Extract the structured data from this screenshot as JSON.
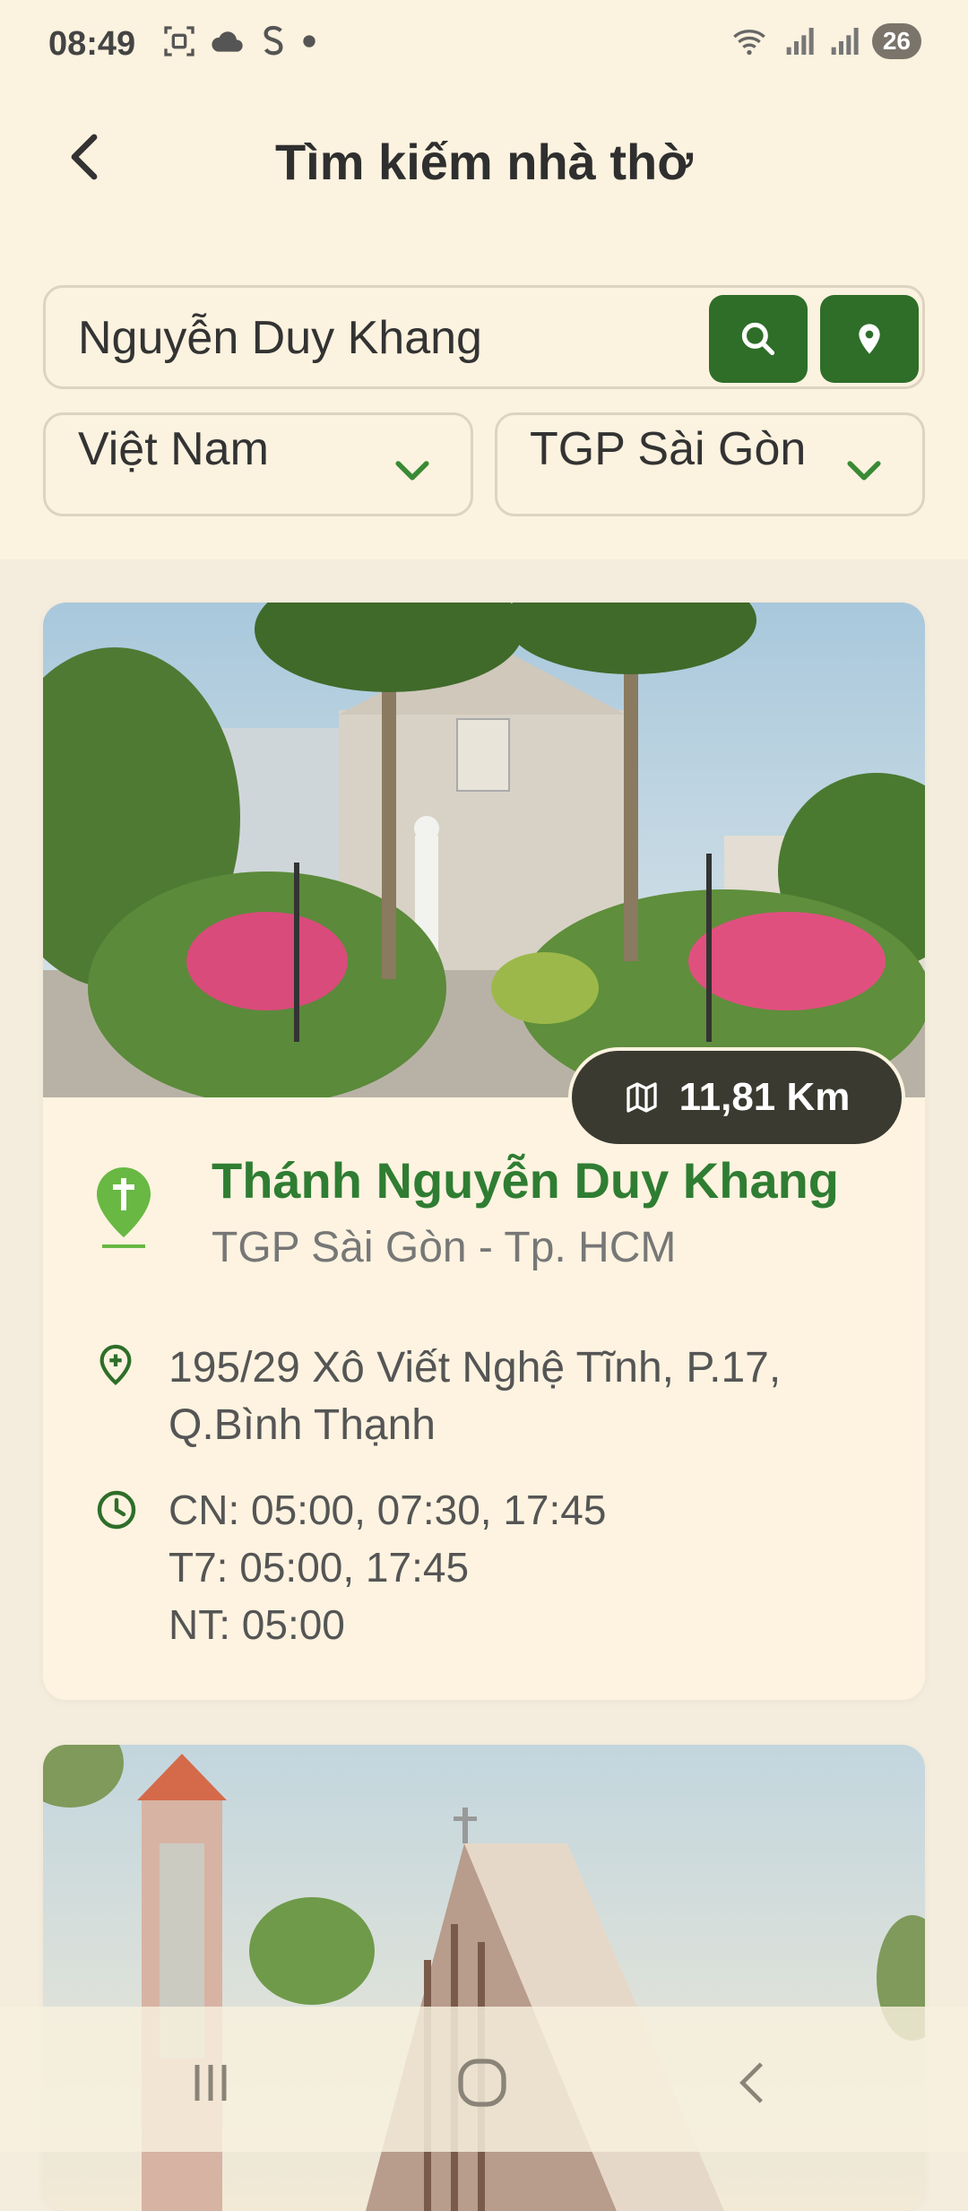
{
  "status": {
    "time": "08:49",
    "battery": "26",
    "icons_left": [
      "screenshot-icon",
      "cloud-icon",
      "s-icon",
      "dot-icon"
    ],
    "icons_right": [
      "wifi-icon",
      "signal-icon",
      "signal-icon"
    ]
  },
  "header": {
    "title": "Tìm kiếm nhà thờ"
  },
  "search": {
    "value": "Nguyễn Duy Khang"
  },
  "filters": {
    "country": "Việt Nam",
    "diocese": "TGP Sài Gòn"
  },
  "results": [
    {
      "distance": "11,81 Km",
      "name": "Thánh Nguyễn Duy Khang",
      "diocese": "TGP Sài Gòn - Tp. HCM",
      "address": "195/29 Xô Viết Nghệ Tĩnh, P.17, Q.Bình Thạnh",
      "mass_times": [
        "CN: 05:00, 07:30, 17:45",
        "T7: 05:00, 17:45",
        "NT: 05:00"
      ]
    }
  ],
  "colors": {
    "accent_green": "#2e6e29",
    "title_green": "#2f7d32",
    "pill_dark": "#3a3a30",
    "background": "#f4ecdc"
  }
}
